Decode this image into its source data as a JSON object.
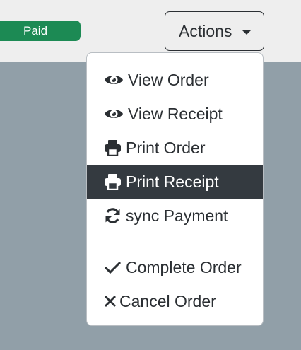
{
  "status_badge": {
    "label": "Paid",
    "color": "#1c8a54"
  },
  "actions_button": {
    "label": "Actions"
  },
  "menu": {
    "items": [
      {
        "label": "View Order",
        "icon": "eye-icon"
      },
      {
        "label": "View Receipt",
        "icon": "eye-icon"
      },
      {
        "label": "Print Order",
        "icon": "print-icon"
      },
      {
        "label": "Print Receipt",
        "icon": "print-icon",
        "active": true
      },
      {
        "label": "sync Payment",
        "icon": "sync-icon"
      },
      {
        "label": "Complete Order",
        "icon": "check-icon"
      },
      {
        "label": "Cancel Order",
        "icon": "close-icon"
      }
    ]
  }
}
